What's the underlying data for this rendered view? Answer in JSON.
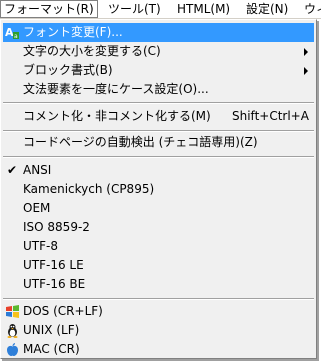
{
  "menubar": {
    "items": [
      {
        "label": "フォーマット(R)"
      },
      {
        "label": "ツール(T)"
      },
      {
        "label": "HTML(M)"
      },
      {
        "label": "設定(N)"
      },
      {
        "label": "ウィ"
      }
    ]
  },
  "menu": {
    "font_change": "フォント変更(F)...",
    "case_change": "文字の大小を変更する(C)",
    "block_format": "ブロック書式(B)",
    "grammar_case": "文法要素を一度にケース設定(O)...",
    "comment_toggle": "コメント化・非コメント化する(M)",
    "comment_shortcut": "Shift+Ctrl+A",
    "codepage_detect": "コードページの自動検出 (チェコ語専用)(Z)",
    "encodings": [
      "ANSI",
      "Kamenickych (CP895)",
      "OEM",
      "ISO 8859-2",
      "UTF-8",
      "UTF-16 LE",
      "UTF-16 BE"
    ],
    "line_endings": [
      "DOS   (CR+LF)",
      "UNIX   (LF)",
      "MAC   (CR)"
    ]
  },
  "colors": {
    "highlight": "#3399ff",
    "menu_bg": "#f0f0f0"
  }
}
